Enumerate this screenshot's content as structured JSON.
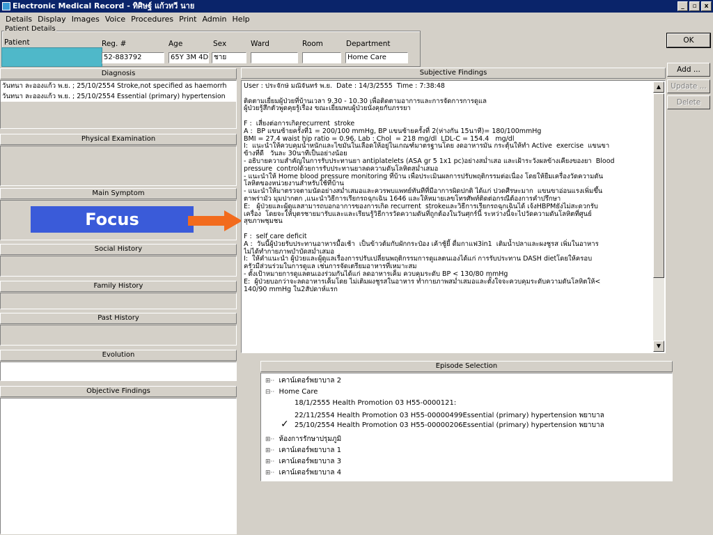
{
  "window": {
    "title": "Electronic Medical Record - ทิศิษฐ์ แก้วทวี นาย",
    "minimize": "_",
    "maximize": "▫",
    "close": "x"
  },
  "menu": [
    "Details",
    "Display",
    "Images",
    "Voice",
    "Procedures",
    "Print",
    "Admin",
    "Help"
  ],
  "patient": {
    "legend": "Patient Details",
    "labels": {
      "patient": "Patient",
      "reg": "Reg. #",
      "age": "Age",
      "sex": "Sex",
      "ward": "Ward",
      "room": "Room",
      "department": "Department"
    },
    "values": {
      "reg": "52-883792",
      "age": "65Y 3M 4D",
      "sex": "ชาย",
      "ward": "",
      "room": "",
      "department": "Home Care"
    }
  },
  "buttons": {
    "ok": "OK",
    "add": "Add ...",
    "update": "Update ...",
    "delete": "Delete"
  },
  "sections": {
    "diagnosis": "Diagnosis",
    "physical": "Physical Examination",
    "main_symptom": "Main Symptom",
    "social": "Social History",
    "family": "Family History",
    "past": "Past History",
    "evolution": "Evolution",
    "objective": "Objective Findings",
    "subjective": "Subjective Findings",
    "episode": "Episode Selection"
  },
  "diagnosis_lines": [
    "วันทนา ละอองแก้ว พ.ย. ; 25/10/2554 Stroke,not specified as haemorrh",
    "วันทนา ละอองแก้ว พ.ย. ; 25/10/2554 Essential (primary) hypertension"
  ],
  "focus_label": "Focus",
  "subjective_lines": [
    "User : ประจักษ์ มณีจันทร์ พ.ย.  Date : 14/3/2555  Time : 7:38:48",
    "",
    "ติดตามเยี่ยมผู้ป่วยที่บ้านเวลา 9.30 - 10.30 เพื่อติดตามอาการและการจัดการการดูแล",
    "ผู้ป่วยรู้สึกตัวพูดคุยรู้เรื่อง ขณะเยี่ยมพบผู้ป่วยนั่งคุยกับภรรยา",
    "",
    "F :  เสี่ยงต่อการเกิดrecurrent  stroke",
    "A :  BP แขนซ้ายครั้งที่1 = 200/100 mmHg, BP แขนซ้ายครั้งที่ 2(ห่างกัน 15นาที)= 180/100mmHg",
    "BMI = 27.4 waist hip ratio = 0.96, Lab : Chol  = 218 mg/dl  LDL-C = 154.4   mg/dl",
    "I:  แนะนำให้ควบคุมน้ำหนักและไขมันในเลือดให้อยู่ในเกณฑ์มาตรฐานโดย งดอาหารมัน กระตุ้นให้ทำ Active  exercise  แขนขา",
    "ข้างที่ดี   วันละ 30นาทีเป็นอย่างน้อย",
    "- อธิบายความสำคัญในการรับประทานยา antiplatelets (ASA gr 5 1x1 pc)อย่างสม่ำเสอ และเฝ้าระวังผลข้างเคียงของยา  Blood",
    "pressure  controlด้วยการรับประทานยาลดความดันโลหิตสม่ำเสมอ",
    "- แนะนำให้ Home blood pressure monitoring ที่บ้าน เพื่อประเมินผลการปรับพฤติกรรมต่อเนื่อง โดยให้ยืมเครื่องวัดความดัน",
    "โลหิตของหน่วยงานสำหรับใช้ที่บ้าน",
    "- แนะนำให้มาตรวจตามนัดอย่างสม่ำเสมอและควรพบแพทย์ทันทีที่มีอาการผิดปกติ ได้แก่ ปวดศีรษะมาก  แขนขาอ่อนแรงเพิ่มขึ้น",
    "ตาพร่ามัว มุมปากตก ,แนะนำวิธีการเรียกรถฉุกเฉิน 1646 และให้หมายเลขโทรศัพท์ติดต่อกรณีต้องการคำปรึกษา",
    "E:   ผู้ป่วยและผู้ดูแลสามารถบอกอาการของการเกิด recurrent  strokeและวิธีการเรียกรถฉุกเฉินได้ เจ้งHBPMยังไม่สะดวกรับ",
    "เครื่อง  โดยจะให้บุตรชายมารับและและเรียนรู้วิธีการวัดความดันที่ถูกต้องในวันศุกร์นี้ ระหว่างนี้จะไปวัดความดันโลหิตที่ศูนย์",
    "สุขภาพชุมชน",
    "",
    "F :  self care deficit",
    "A :  วันนี้ผู้ป่วยรับประทานอาหารมื้อเช้า  เป็นข้าวต้มกับผักกระป๋อง เค้าชู้ยี้ ดื่มกาแฟ3in1  เติมน้ำปลาและผงชูรส เพิ่มในอาหาร",
    "ไม่ได้ทำกายภาพบำบัดสม่ำเสมอ",
    "I:  ให้คำแนะนำ ผู้ป่วยและผู้ดูแลเรื่องการปรับเปลี่ยนพฤติกรรมการดูแลตนเองได้แก่ การรับประทาน DASH dietโดยให้ครอบ",
    "ครัวมีส่วนร่วมในการดูแล เช่นการจัดเตรียมอาหารที่เหมาะสม",
    "- ตั้งเป้าหมายการดูแลตนเองร่วมกันได้แก่ ลดอาหารเค็ม ควบคุมระดับ BP < 130/80 mmHg",
    "E:  ผู้ป่วยบอกว่าจะลดอาหารเค็มโดย ไม่เติมผงชูรสในอาหาร ทำกายภาพสม่ำเสมอและตั้งใจจะควบคุมระดับความดันโลหิตให้<",
    "140/90 mmHg ใน2สัปดาห์แรก"
  ],
  "episodes": [
    {
      "toggle": "⊞··",
      "label": "เคาน์เตอร์พยาบาล 2"
    },
    {
      "toggle": "⊟··",
      "label": "Home Care"
    },
    {
      "toggle": "",
      "label": "18/1/2555 Health Promotion 03 H55-0000121:"
    },
    {
      "toggle": "",
      "label": "22/11/2554 Health Promotion 03 H55-00000499Essential (primary) hypertension พยาบาล"
    },
    {
      "toggle": "",
      "label": "25/10/2554 Health Promotion  03 H55-00000206Essential (primary) hypertension พยาบาล"
    },
    {
      "toggle": "⊞··",
      "label": "ห้องการรักษาปรุมภูมิ"
    },
    {
      "toggle": "⊞··",
      "label": "เคาน์เตอร์พยาบาล 1"
    },
    {
      "toggle": "⊞··",
      "label": "เคาน์เตอร์พยาบาล 3"
    },
    {
      "toggle": "⊞··",
      "label": "เคาน์เตอร์พยาบาล 4"
    }
  ],
  "check_glyph": "✓",
  "scroll": {
    "up": "▲",
    "down": "▼"
  },
  "colors": {
    "title_bar": "#0a246a",
    "focus_box": "#3a5bd9",
    "arrow": "#f26b1d",
    "redaction": "#4fb8c9"
  }
}
